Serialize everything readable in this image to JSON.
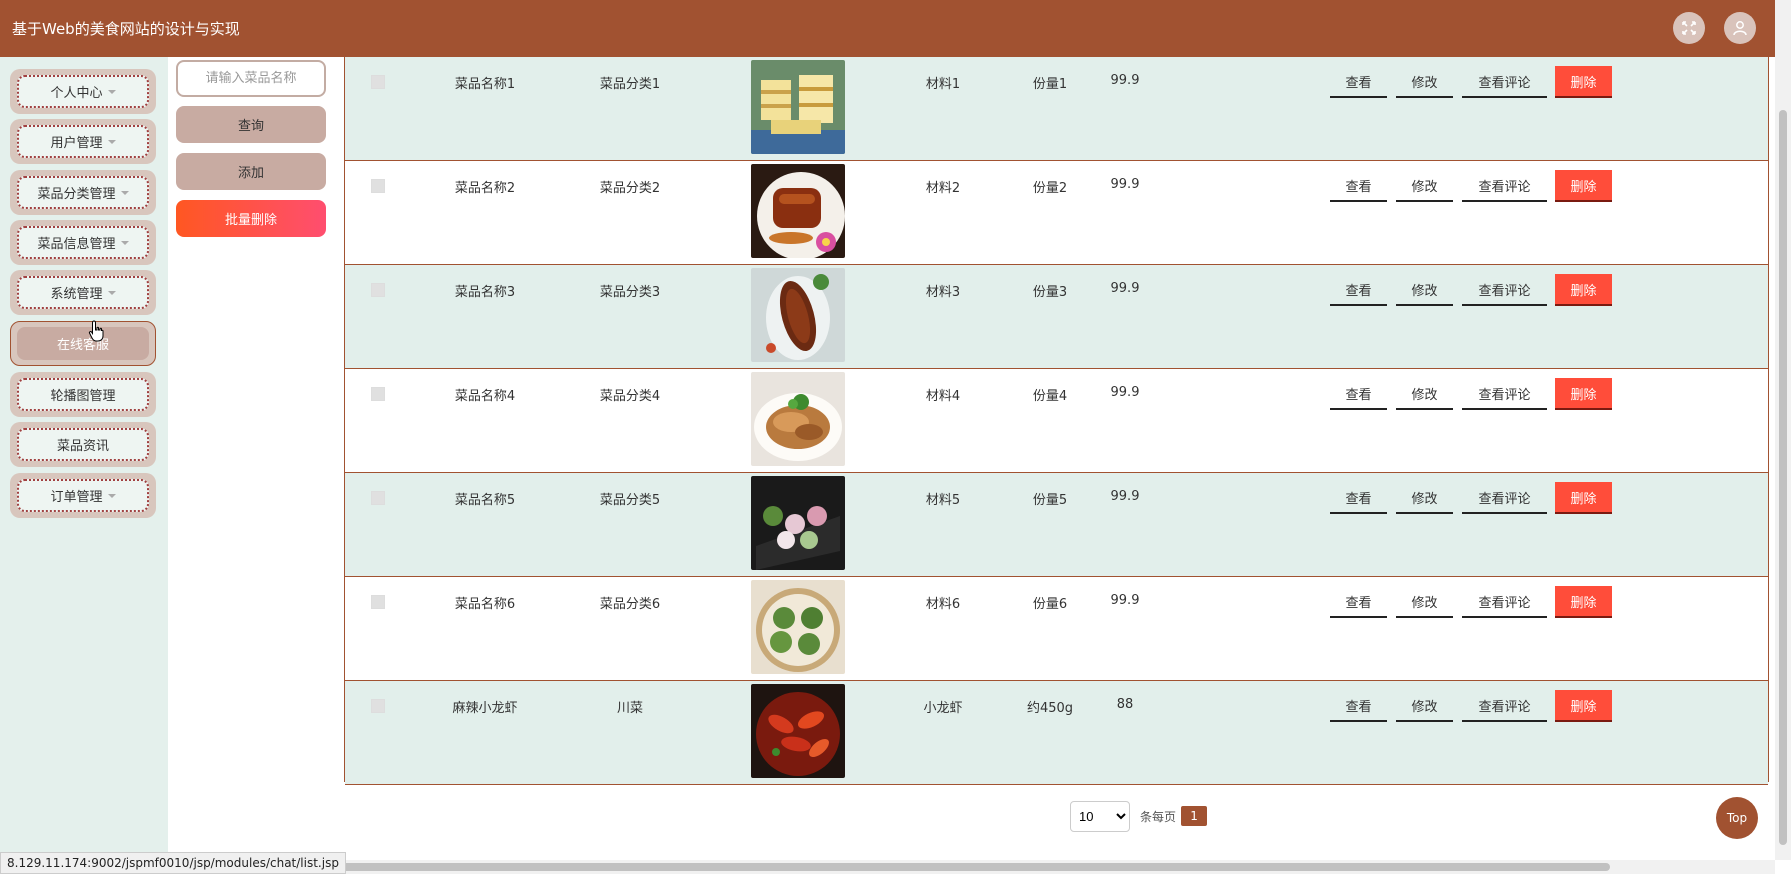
{
  "app": {
    "title": "基于Web的美食网站的设计与实现"
  },
  "sidebar": {
    "items": [
      {
        "label": "个人中心",
        "has_caret": true
      },
      {
        "label": "用户管理",
        "has_caret": true
      },
      {
        "label": "菜品分类管理",
        "has_caret": true
      },
      {
        "label": "菜品信息管理",
        "has_caret": true
      },
      {
        "label": "系统管理",
        "has_caret": true
      },
      {
        "label": "在线客服",
        "has_caret": false,
        "active": true
      },
      {
        "label": "轮播图管理",
        "has_caret": false
      },
      {
        "label": "菜品资讯",
        "has_caret": false
      },
      {
        "label": "订单管理",
        "has_caret": true
      }
    ]
  },
  "controls": {
    "search_placeholder": "请输入菜品名称",
    "query_label": "查询",
    "add_label": "添加",
    "batch_delete_label": "批量删除"
  },
  "actions": {
    "view": "查看",
    "edit": "修改",
    "review": "查看评论",
    "delete": "删除"
  },
  "rows": [
    {
      "name": "菜品名称1",
      "category": "菜品分类1",
      "material": "材料1",
      "portion": "份量1",
      "price": "99.9",
      "image": "layered-cake-dessert"
    },
    {
      "name": "菜品名称2",
      "category": "菜品分类2",
      "material": "材料2",
      "portion": "份量2",
      "price": "99.9",
      "image": "braised-pork-dish"
    },
    {
      "name": "菜品名称3",
      "category": "菜品分类3",
      "material": "材料3",
      "portion": "份量3",
      "price": "99.9",
      "image": "braised-fish-dish"
    },
    {
      "name": "菜品名称4",
      "category": "菜品分类4",
      "material": "材料4",
      "portion": "份量4",
      "price": "99.9",
      "image": "sliced-meat-dish"
    },
    {
      "name": "菜品名称5",
      "category": "菜品分类5",
      "material": "材料5",
      "portion": "份量5",
      "price": "99.9",
      "image": "dim-sum-plate"
    },
    {
      "name": "菜品名称6",
      "category": "菜品分类6",
      "material": "材料6",
      "portion": "份量6",
      "price": "99.9",
      "image": "green-dumplings"
    },
    {
      "name": "麻辣小龙虾",
      "category": "川菜",
      "material": "小龙虾",
      "portion": "约450g",
      "price": "88",
      "image": "spicy-crayfish"
    }
  ],
  "pager": {
    "page_size": "10",
    "page_size_options": [
      "10"
    ],
    "per_page_label": "条每页",
    "current_page": "1"
  },
  "top_button": "Top",
  "status_url": "8.129.11.174:9002/jspmf0010/jsp/modules/chat/list.jsp",
  "colors": {
    "brand": "#a15231",
    "danger": "#ff4d3a",
    "row_alt": "#e2efeb",
    "sidebar_bg": "#e4f0ec"
  },
  "icons": {
    "fullscreen": "fullscreen-icon",
    "user": "user-icon",
    "cursor": "hand-cursor-icon"
  }
}
